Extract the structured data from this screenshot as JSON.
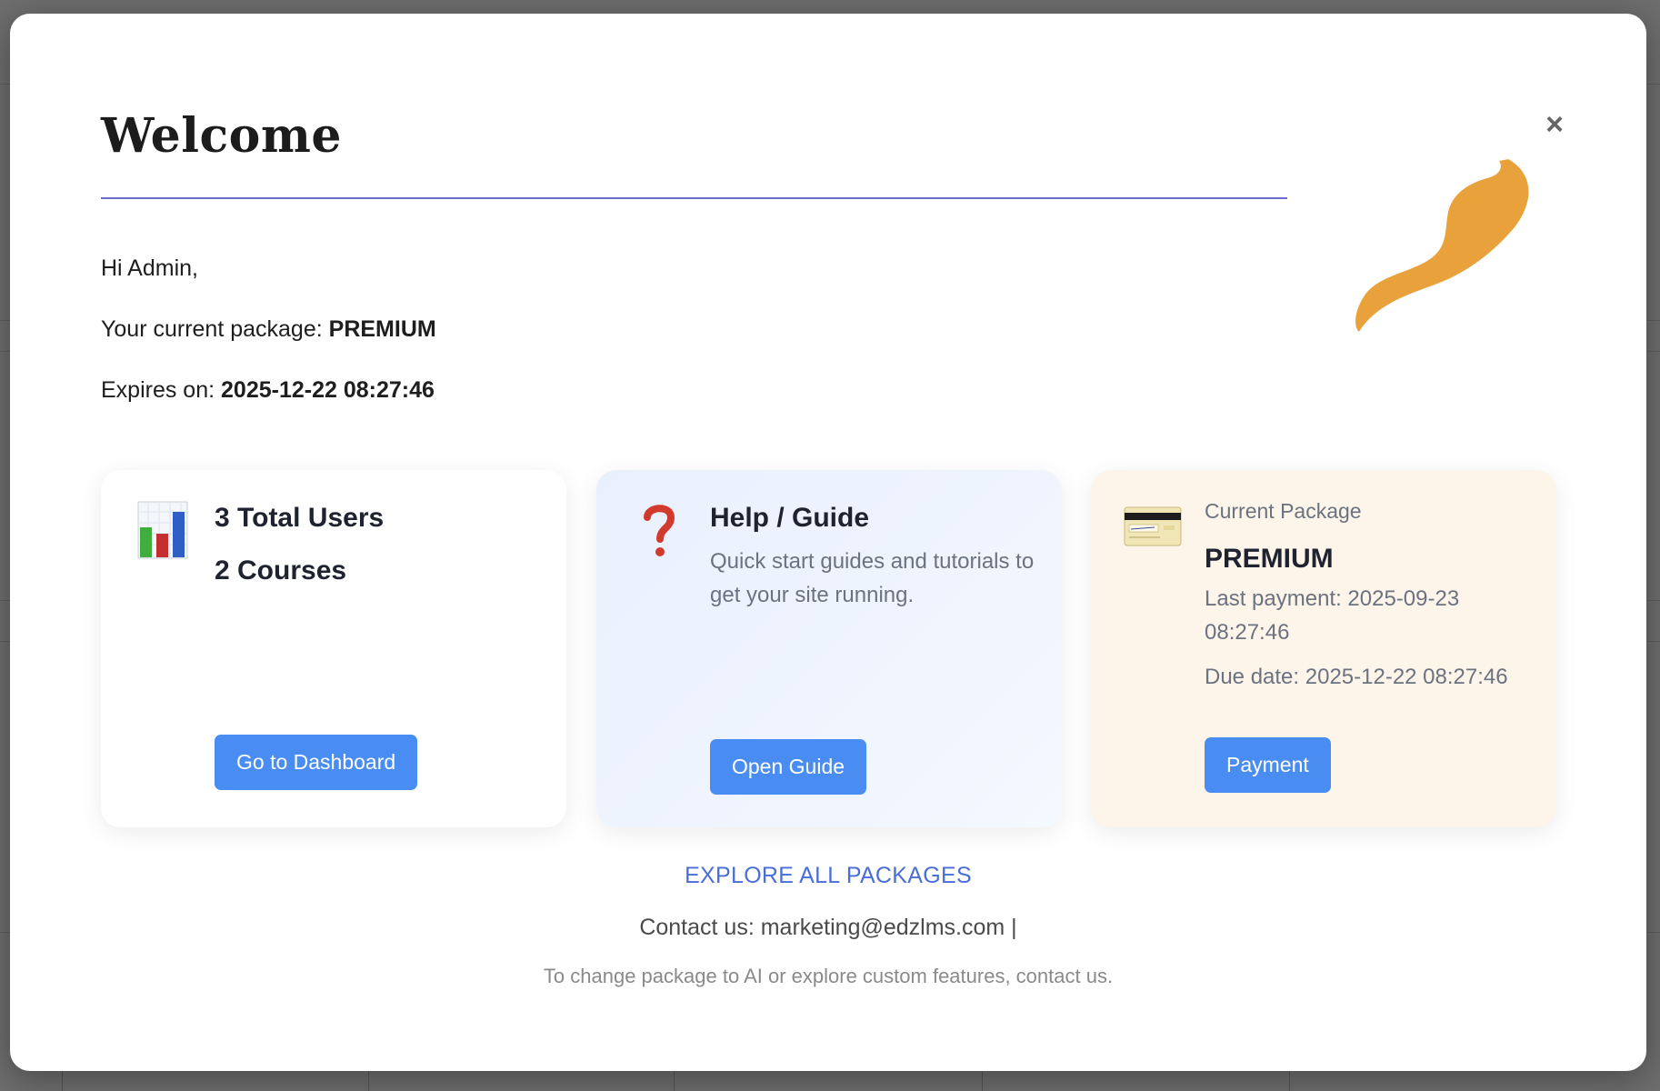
{
  "modal": {
    "title": "Welcome",
    "close_symbol": "×",
    "greeting": "Hi Admin,",
    "package_label": "Your current package:",
    "package_value": "PREMIUM",
    "expires_label": "Expires on:",
    "expires_value": "2025-12-22 08:27:46"
  },
  "cards": {
    "users": {
      "icon": "bar-chart-icon",
      "total_users": "3 Total Users",
      "courses": "2 Courses",
      "button_label": "Go to Dashboard"
    },
    "help": {
      "icon": "question-mark-icon",
      "heading": "Help / Guide",
      "description": "Quick start guides and tutorials to get your site running.",
      "button_label": "Open Guide"
    },
    "package": {
      "icon": "credit-card-icon",
      "kicker": "Current Package",
      "name": "PREMIUM",
      "last_payment": "Last payment: 2025-09-23 08:27:46",
      "due_date": "Due date: 2025-12-22 08:27:46",
      "button_label": "Payment"
    }
  },
  "footer": {
    "explore_label": "EXPLORE ALL PACKAGES",
    "contact": "Contact us: marketing@edzlms.com |",
    "note": "To change package to AI or explore custom features, contact us."
  },
  "colors": {
    "accent": "#4a8df2",
    "link": "#4a6ed8",
    "rule": "#6a6fcf",
    "mascot": "#e9a23b"
  }
}
